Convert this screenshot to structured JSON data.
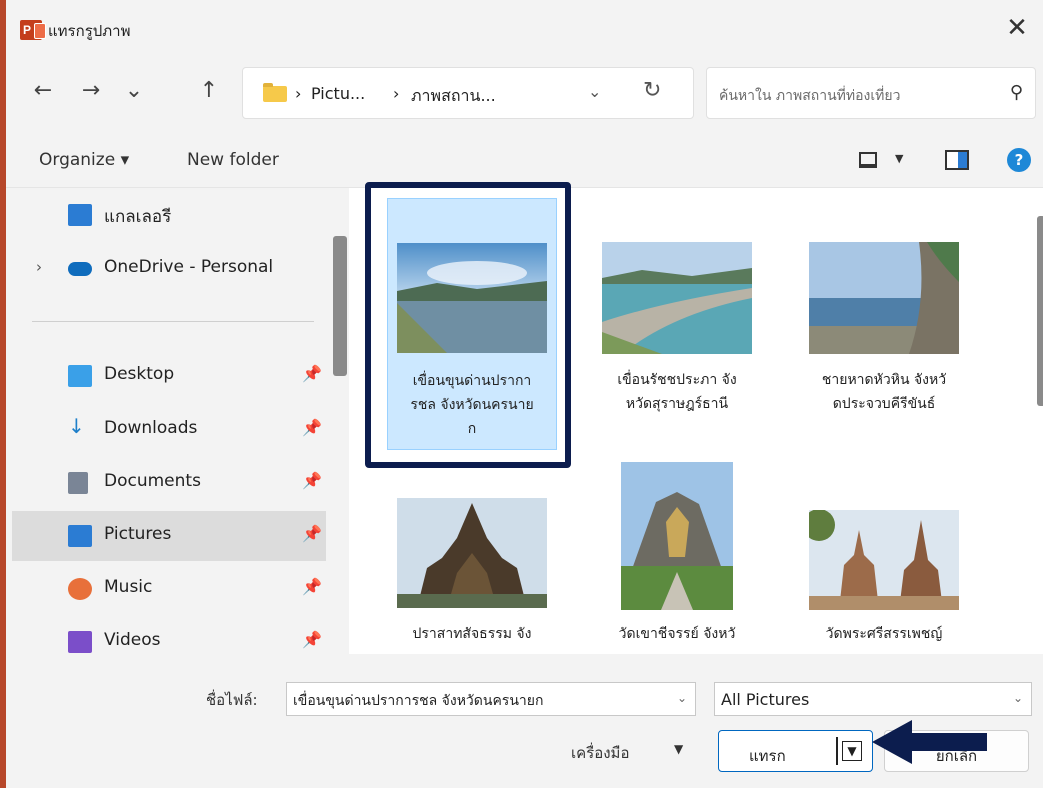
{
  "window": {
    "title": "แทรกรูปภาพ",
    "app_icon_text": "P"
  },
  "nav": {
    "back": "←",
    "forward": "→",
    "recent": "⌄",
    "up": "↑",
    "breadcrumb": [
      "Pictu...",
      "ภาพสถาน..."
    ],
    "separator": "›",
    "search_placeholder": "ค้นหาใน ภาพสถานที่ท่องเที่ยว"
  },
  "toolbar": {
    "organize": "Organize ▾",
    "new_folder": "New folder",
    "help": "?"
  },
  "sidebar": {
    "items": [
      {
        "label": "แกลเลอรี",
        "icon": "gallery-icon",
        "color": "#2b7cd3"
      },
      {
        "label": "OneDrive - Personal",
        "icon": "onedrive-icon",
        "color": "#0f6cbd"
      },
      {
        "label": "Desktop",
        "icon": "desktop-icon",
        "color": "#3aa0e8",
        "pinned": true
      },
      {
        "label": "Downloads",
        "icon": "downloads-icon",
        "color": "#1e7fc9",
        "pinned": true
      },
      {
        "label": "Documents",
        "icon": "documents-icon",
        "color": "#7a8596",
        "pinned": true
      },
      {
        "label": "Pictures",
        "icon": "pictures-icon",
        "color": "#2b7cd3",
        "pinned": true,
        "selected": true
      },
      {
        "label": "Music",
        "icon": "music-icon",
        "color": "#e8703a",
        "pinned": true
      },
      {
        "label": "Videos",
        "icon": "videos-icon",
        "color": "#7b4ec9",
        "pinned": true
      }
    ]
  },
  "files": [
    {
      "caption": "เขื่อนขุนด่านปราการชล จังหวัดนครนายก",
      "lines": [
        "เขื่อนขุนด่านปรากา",
        "รชล จังหวัดนครนาย",
        "ก"
      ],
      "selected": true
    },
    {
      "caption": "เขื่อนรัชชประภา จังหวัดสุราษฎร์ธานี",
      "lines": [
        "เขื่อนรัชชประภา จัง",
        "หวัดสุราษฎร์ธานี"
      ]
    },
    {
      "caption": "ชายหาดหัวหิน จังหวัดประจวบคีรีขันธ์",
      "lines": [
        "ชายหาดหัวหิน จังหวั",
        "ดประจวบคีรีขันธ์"
      ]
    },
    {
      "caption": "ปราสาทสัจธรรม จัง",
      "lines": [
        "ปราสาทสัจธรรม จัง"
      ]
    },
    {
      "caption": "วัดเขาชีจรรย์ จังหวั",
      "lines": [
        "วัดเขาชีจรรย์ จังหวั"
      ]
    },
    {
      "caption": "วัดพระศรีสรรเพชญ์",
      "lines": [
        "วัดพระศรีสรรเพชญ์"
      ]
    }
  ],
  "bottom": {
    "file_name_label": "ชื่อไฟล์:",
    "file_name_value": "เขื่อนขุนด่านปราการชล จังหวัดนครนายก",
    "file_type": "All Pictures",
    "tools": "เครื่องมือ",
    "insert": "แทรก",
    "cancel": "ยกเลิก"
  },
  "colors": {
    "accent": "#0067c0",
    "highlight_frame": "#0c1d4e",
    "selection": "#cce8ff"
  }
}
